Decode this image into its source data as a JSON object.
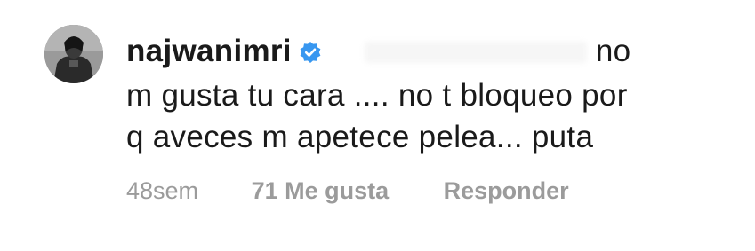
{
  "comment": {
    "username": "najwanimri",
    "verified_icon": "verified-badge-icon",
    "avatar_icon": "profile-avatar",
    "line1_tail": "no",
    "line2": "m gusta tu cara .... no t bloqueo por",
    "line3": "q aveces m apetece pelea... puta",
    "time": "48sem",
    "likes": "71 Me gusta",
    "reply_label": "Responder"
  },
  "colors": {
    "text": "#1a1a1a",
    "meta": "#9b9b9b",
    "verified": "#3897f0",
    "background": "#ffffff"
  }
}
